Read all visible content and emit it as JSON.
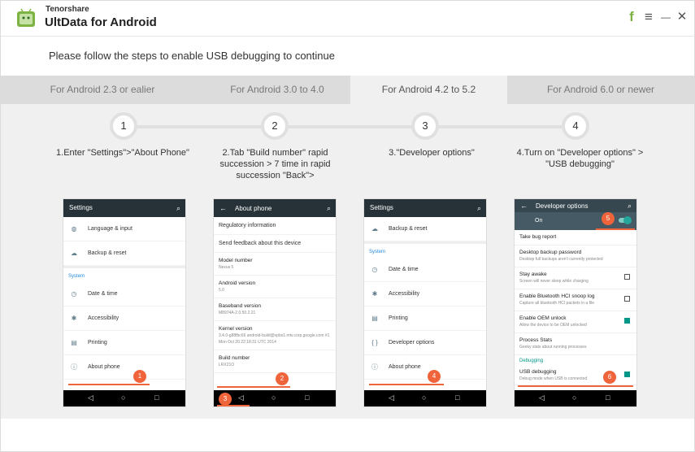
{
  "app": {
    "brand_small": "Tenorshare",
    "brand_title": "UltData for Android"
  },
  "titlebar": {
    "facebook_glyph": "f",
    "menu_glyph": "≡",
    "minimize_glyph": "—",
    "close_glyph": "✕"
  },
  "instruction": "Please follow the steps to enable USB debugging to continue",
  "tabs": [
    {
      "label": "For Android 2.3 or ealier"
    },
    {
      "label": "For Android 3.0 to 4.0"
    },
    {
      "label": "For Android 4.2 to 5.2"
    },
    {
      "label": "For Android 6.0 or newer"
    }
  ],
  "steps": [
    {
      "num": "1",
      "label": "1.Enter \"Settings\">\"About Phone\""
    },
    {
      "num": "2",
      "label": "2.Tab \"Build number\" rapid succession > 7 time in rapid succession \"Back\">"
    },
    {
      "num": "3",
      "label": "3.\"Developer options\""
    },
    {
      "num": "4",
      "label": "4.Turn on \"Developer options\" > \"USB debugging\""
    }
  ],
  "phone1": {
    "title": "Settings",
    "items": [
      "Language & input",
      "Backup & reset"
    ],
    "section": "System",
    "items2": [
      "Date & time",
      "Accessibility",
      "Printing",
      "About phone"
    ],
    "badge": "1"
  },
  "phone2": {
    "title": "About phone",
    "rows": [
      "Regulatory information",
      "Send feedback about this device"
    ],
    "details": [
      {
        "t": "Model number",
        "s": "Nexus 5"
      },
      {
        "t": "Android version",
        "s": "5.0"
      },
      {
        "t": "Baseband version",
        "s": "M8974A-2.0.50.2.21"
      },
      {
        "t": "Kernel version",
        "s": "3.4.0-g88fbc66 android-build@vpbs1.mtv.corp.google.com #1 Mon Oct 20 22:18:31 UTC 2014"
      },
      {
        "t": "Build number",
        "s": "LRX21O"
      }
    ],
    "badge_build": "2",
    "badge_back": "3"
  },
  "phone3": {
    "title": "Settings",
    "items": [
      "Backup & reset"
    ],
    "section": "System",
    "items2": [
      "Date & time",
      "Accessibility",
      "Printing",
      "Developer options",
      "About phone"
    ],
    "badge": "4"
  },
  "phone4": {
    "title": "Developer options",
    "on_label": "On",
    "rows": [
      {
        "t": "Take bug report",
        "s": ""
      },
      {
        "t": "Desktop backup password",
        "s": "Desktop full backups aren't currently protected"
      },
      {
        "t": "Stay awake",
        "s": "Screen will never sleep while charging"
      },
      {
        "t": "Enable Bluetooth HCI snoop log",
        "s": "Capture all bluetooth HCI packets in a file"
      },
      {
        "t": "Enable OEM unlock",
        "s": "Allow the device to be OEM unlocked"
      },
      {
        "t": "Process Stats",
        "s": "Geeky stats about running processes"
      }
    ],
    "section": "Debugging",
    "usb": {
      "t": "USB debugging",
      "s": "Debug mode when USB is connected"
    },
    "badge_on": "5",
    "badge_usb": "6"
  },
  "nav": {
    "back": "◁",
    "home": "○",
    "recent": "□"
  },
  "icons": {
    "search": "🔍"
  }
}
